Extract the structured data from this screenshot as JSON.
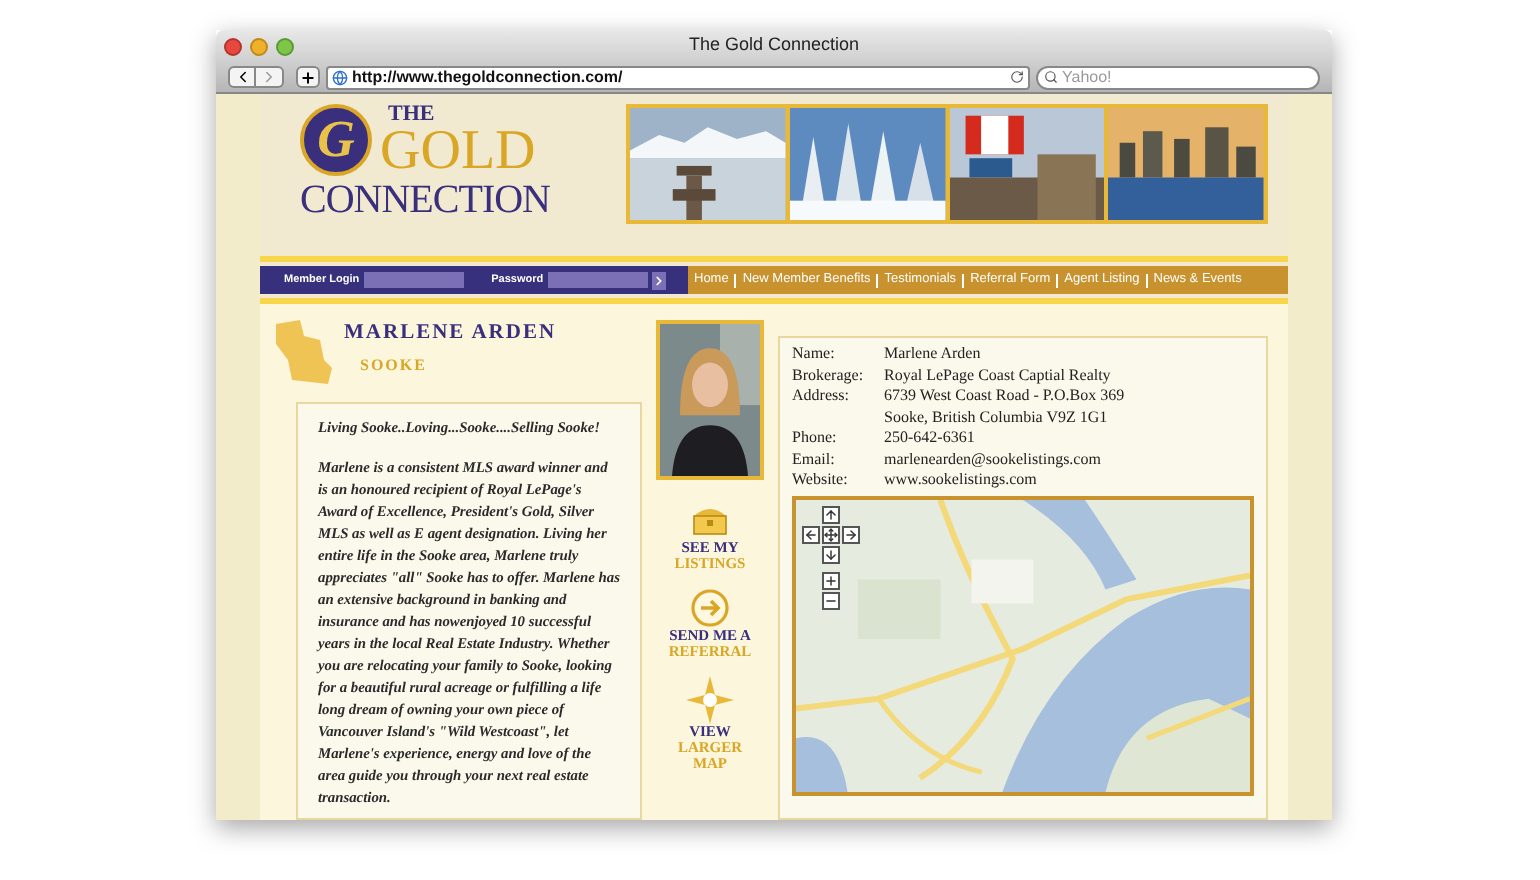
{
  "window": {
    "title": "The Gold Connection"
  },
  "toolbar": {
    "url": "http://www.thegoldconnection.com/",
    "search_placeholder": "Yahoo!"
  },
  "logo": {
    "monogram": "G",
    "line_1": "THE",
    "line_2": "GOLD",
    "line_3": "CONNECTION"
  },
  "login": {
    "member_label": "Member Login",
    "password_label": "Password"
  },
  "nav": [
    "Home",
    "New Member Benefits",
    "Testimonials",
    "Referral Form",
    "Agent Listing",
    "News & Events"
  ],
  "agent": {
    "name": "MARLENE ARDEN",
    "area": "SOOKE"
  },
  "bio": {
    "tagline": "Living Sooke..Loving...Sooke....Selling Sooke!",
    "text": "Marlene is a consistent MLS award winner and is an honoured recipient of Royal LePage's Award of Excellence, President's Gold, Silver MLS as well as E agent designation. Living her entire life in the Sooke area, Marlene truly appreciates \"all\" Sooke has to offer. Marlene has an extensive background in banking and insurance and has nowenjoyed 10 successful years in the local Real Estate Industry. Whether you are relocating your family to Sooke, looking for a beautiful rural acreage or fulfilling a life long dream of owning your own piece of Vancouver Island's \"Wild Westcoast\", let Marlene's experience, energy and love of the area guide you through your next real estate transaction."
  },
  "actions": [
    {
      "kind": "listings",
      "lines": [
        "SEE MY",
        "LISTINGS"
      ]
    },
    {
      "kind": "referral",
      "lines": [
        "SEND ME A",
        "REFERRAL"
      ]
    },
    {
      "kind": "map",
      "lines": [
        "VIEW",
        "LARGER",
        "MAP"
      ]
    }
  ],
  "details": [
    {
      "label": "Name:",
      "values": [
        "Marlene Arden"
      ]
    },
    {
      "label": "Brokerage:",
      "values": [
        "Royal LePage Coast Captial Realty"
      ]
    },
    {
      "label": "Address:",
      "values": [
        "6739 West Coast Road - P.O.Box 369",
        "Sooke, British Columbia V9Z 1G1"
      ]
    },
    {
      "label": "Phone:",
      "values": [
        "250-642-6361"
      ]
    },
    {
      "label": "Email:",
      "values": [
        "marlenearden@sookelistings.com"
      ]
    },
    {
      "label": "Website:",
      "values": [
        "www.sookelistings.com"
      ]
    }
  ]
}
